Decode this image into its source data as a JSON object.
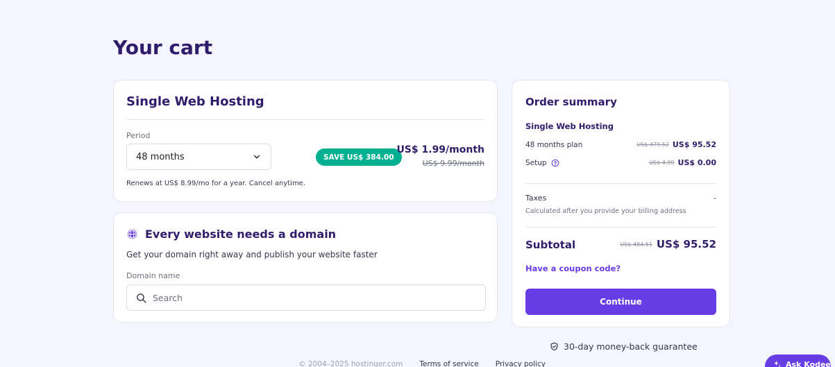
{
  "page": {
    "title": "Your cart"
  },
  "plan": {
    "name": "Single Web Hosting",
    "period_label": "Period",
    "period_value": "48 months",
    "save_badge": "SAVE US$ 384.00",
    "price_monthly": "US$ 1.99/month",
    "price_old_monthly": "US$ 9.99/month",
    "renew_note": "Renews at US$ 8.99/mo for a year. Cancel anytime."
  },
  "domain": {
    "title": "Every website needs a domain",
    "subtitle": "Get your domain right away and publish your website faster",
    "field_label": "Domain name",
    "search_placeholder": "Search"
  },
  "summary": {
    "title": "Order summary",
    "plan_name": "Single Web Hosting",
    "plan_row_label": "48 months plan",
    "plan_row_old": "US$ 479.52",
    "plan_row_new": "US$ 95.52",
    "setup_label": "Setup",
    "setup_old": "US$ 4.99",
    "setup_new": "US$ 0.00",
    "taxes_label": "Taxes",
    "taxes_value": "-",
    "taxes_note": "Calculated after you provide your billing address",
    "subtotal_label": "Subtotal",
    "subtotal_old": "US$ 484.51",
    "subtotal_new": "US$ 95.52",
    "coupon_link": "Have a coupon code?",
    "continue_label": "Continue"
  },
  "guarantee": "30-day money-back guarantee",
  "footer": {
    "copyright": "© 2004–2025 hostinger.com",
    "terms": "Terms of service",
    "privacy": "Privacy policy"
  },
  "assistant": {
    "label": "Ask Kodee"
  },
  "colors": {
    "primary": "#673de6",
    "heading": "#2f1c6a",
    "save_badge": "#00b090",
    "background": "#f4f5ff"
  },
  "icons": [
    "chevron-down-icon",
    "globe-icon",
    "search-icon",
    "help-icon",
    "shield-check-icon",
    "sparkle-icon"
  ]
}
